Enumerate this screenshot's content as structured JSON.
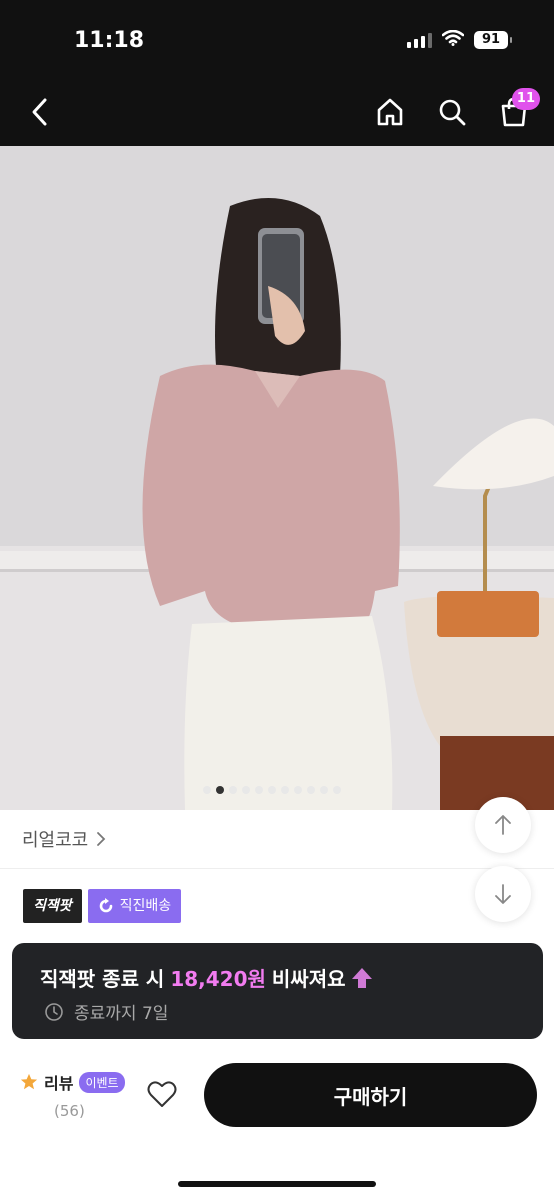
{
  "status_bar": {
    "time": "11:18",
    "battery": "91",
    "icons": [
      "signal-icon",
      "wifi-icon",
      "battery-icon"
    ]
  },
  "header": {
    "back_icon": "chevron-left-icon",
    "home_icon": "home-icon",
    "search_icon": "search-icon",
    "cart_icon": "shopping-bag-icon",
    "cart_count": "11"
  },
  "product_image": {
    "pager_total": 11,
    "pager_active": 1
  },
  "brand": {
    "name": "리얼코코",
    "chevron_icon": "chevron-right-icon"
  },
  "tags": {
    "sale_tag": "직잭팟",
    "delivery_tag": "직진배송",
    "delivery_icon": "refresh-icon"
  },
  "scroll_buttons": {
    "up_icon": "arrow-up-icon",
    "down_icon": "arrow-down-icon"
  },
  "toast": {
    "prefix": "직잭팟 종료 시",
    "price": "18,420원",
    "suffix": "비싸져요",
    "arrow_icon": "arrow-up-icon",
    "clock_icon": "clock-icon",
    "remaining": "종료까지 7일"
  },
  "bottom_bar": {
    "star_icon": "star-icon",
    "review_label": "리뷰",
    "event_badge": "이벤트",
    "review_count": "(56)",
    "heart_icon": "heart-icon",
    "buy_label": "구매하기"
  },
  "colors": {
    "accent": "#e052ec",
    "purple": "#8a6cf0",
    "price_highlight": "#f27cf0",
    "dark": "#111111"
  }
}
